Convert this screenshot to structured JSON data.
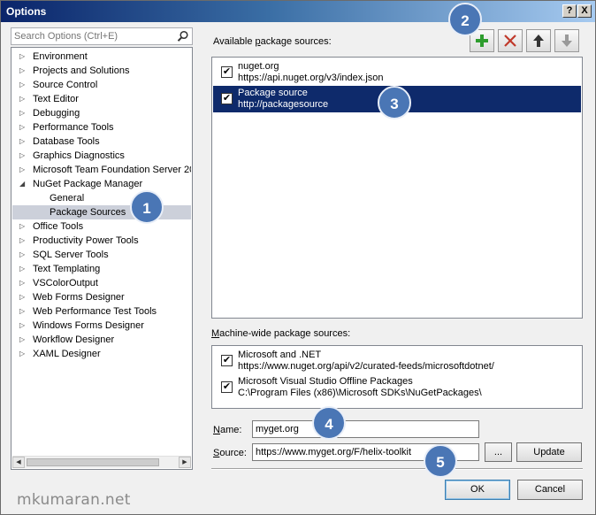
{
  "window": {
    "title": "Options",
    "help_label": "?",
    "close_label": "X"
  },
  "search": {
    "placeholder": "Search Options (Ctrl+E)",
    "icon": "magnifier-icon"
  },
  "tree": {
    "items": [
      {
        "label": "Environment",
        "expanded": false
      },
      {
        "label": "Projects and Solutions",
        "expanded": false
      },
      {
        "label": "Source Control",
        "expanded": false
      },
      {
        "label": "Text Editor",
        "expanded": false
      },
      {
        "label": "Debugging",
        "expanded": false
      },
      {
        "label": "Performance Tools",
        "expanded": false
      },
      {
        "label": "Database Tools",
        "expanded": false
      },
      {
        "label": "Graphics Diagnostics",
        "expanded": false
      },
      {
        "label": "Microsoft Team Foundation Server 20",
        "expanded": false
      },
      {
        "label": "NuGet Package Manager",
        "expanded": true
      },
      {
        "label": "General",
        "child": true
      },
      {
        "label": "Package Sources",
        "child": true,
        "selected": true
      },
      {
        "label": "Office Tools",
        "expanded": false
      },
      {
        "label": "Productivity Power Tools",
        "expanded": false
      },
      {
        "label": "SQL Server Tools",
        "expanded": false
      },
      {
        "label": "Text Templating",
        "expanded": false
      },
      {
        "label": "VSColorOutput",
        "expanded": false
      },
      {
        "label": "Web Forms Designer",
        "expanded": false
      },
      {
        "label": "Web Performance Test Tools",
        "expanded": false
      },
      {
        "label": "Windows Forms Designer",
        "expanded": false
      },
      {
        "label": "Workflow Designer",
        "expanded": false
      },
      {
        "label": "XAML Designer",
        "expanded": false
      }
    ]
  },
  "available": {
    "label_pre": "Available ",
    "label_key": "p",
    "label_post": "ackage sources:",
    "sources": [
      {
        "name": "nuget.org",
        "url": "https://api.nuget.org/v3/index.json",
        "checked": true,
        "selected": false
      },
      {
        "name": "Package source",
        "url": "http://packagesource",
        "checked": true,
        "selected": true
      }
    ]
  },
  "toolbar": {
    "add_icon": "plus-icon",
    "remove_icon": "delete-x-icon",
    "up_icon": "arrow-up-icon",
    "down_icon": "arrow-down-icon",
    "add_color": "#2e9d2e",
    "remove_color": "#c0392b"
  },
  "machine": {
    "label_key": "M",
    "label_post": "achine-wide package sources:",
    "sources": [
      {
        "name": "Microsoft and .NET",
        "url": "https://www.nuget.org/api/v2/curated-feeds/microsoftdotnet/",
        "checked": true
      },
      {
        "name": "Microsoft Visual Studio Offline Packages",
        "url": "C:\\Program Files (x86)\\Microsoft SDKs\\NuGetPackages\\",
        "checked": true
      }
    ]
  },
  "form": {
    "name_key": "N",
    "name_post": "ame:",
    "name_value": "myget.org",
    "source_key": "S",
    "source_post": "ource:",
    "source_value": "https://www.myget.org/F/helix-toolkit",
    "browse_label": "...",
    "update_label": "Update"
  },
  "footer": {
    "ok_label": "OK",
    "cancel_label": "Cancel"
  },
  "badges": [
    "1",
    "2",
    "3",
    "4",
    "5"
  ],
  "watermark": "mkumaran.net",
  "colors": {
    "selection": "#0e2a6b",
    "badge": "#4a76b5",
    "tree_selected": "#ccd0da"
  }
}
